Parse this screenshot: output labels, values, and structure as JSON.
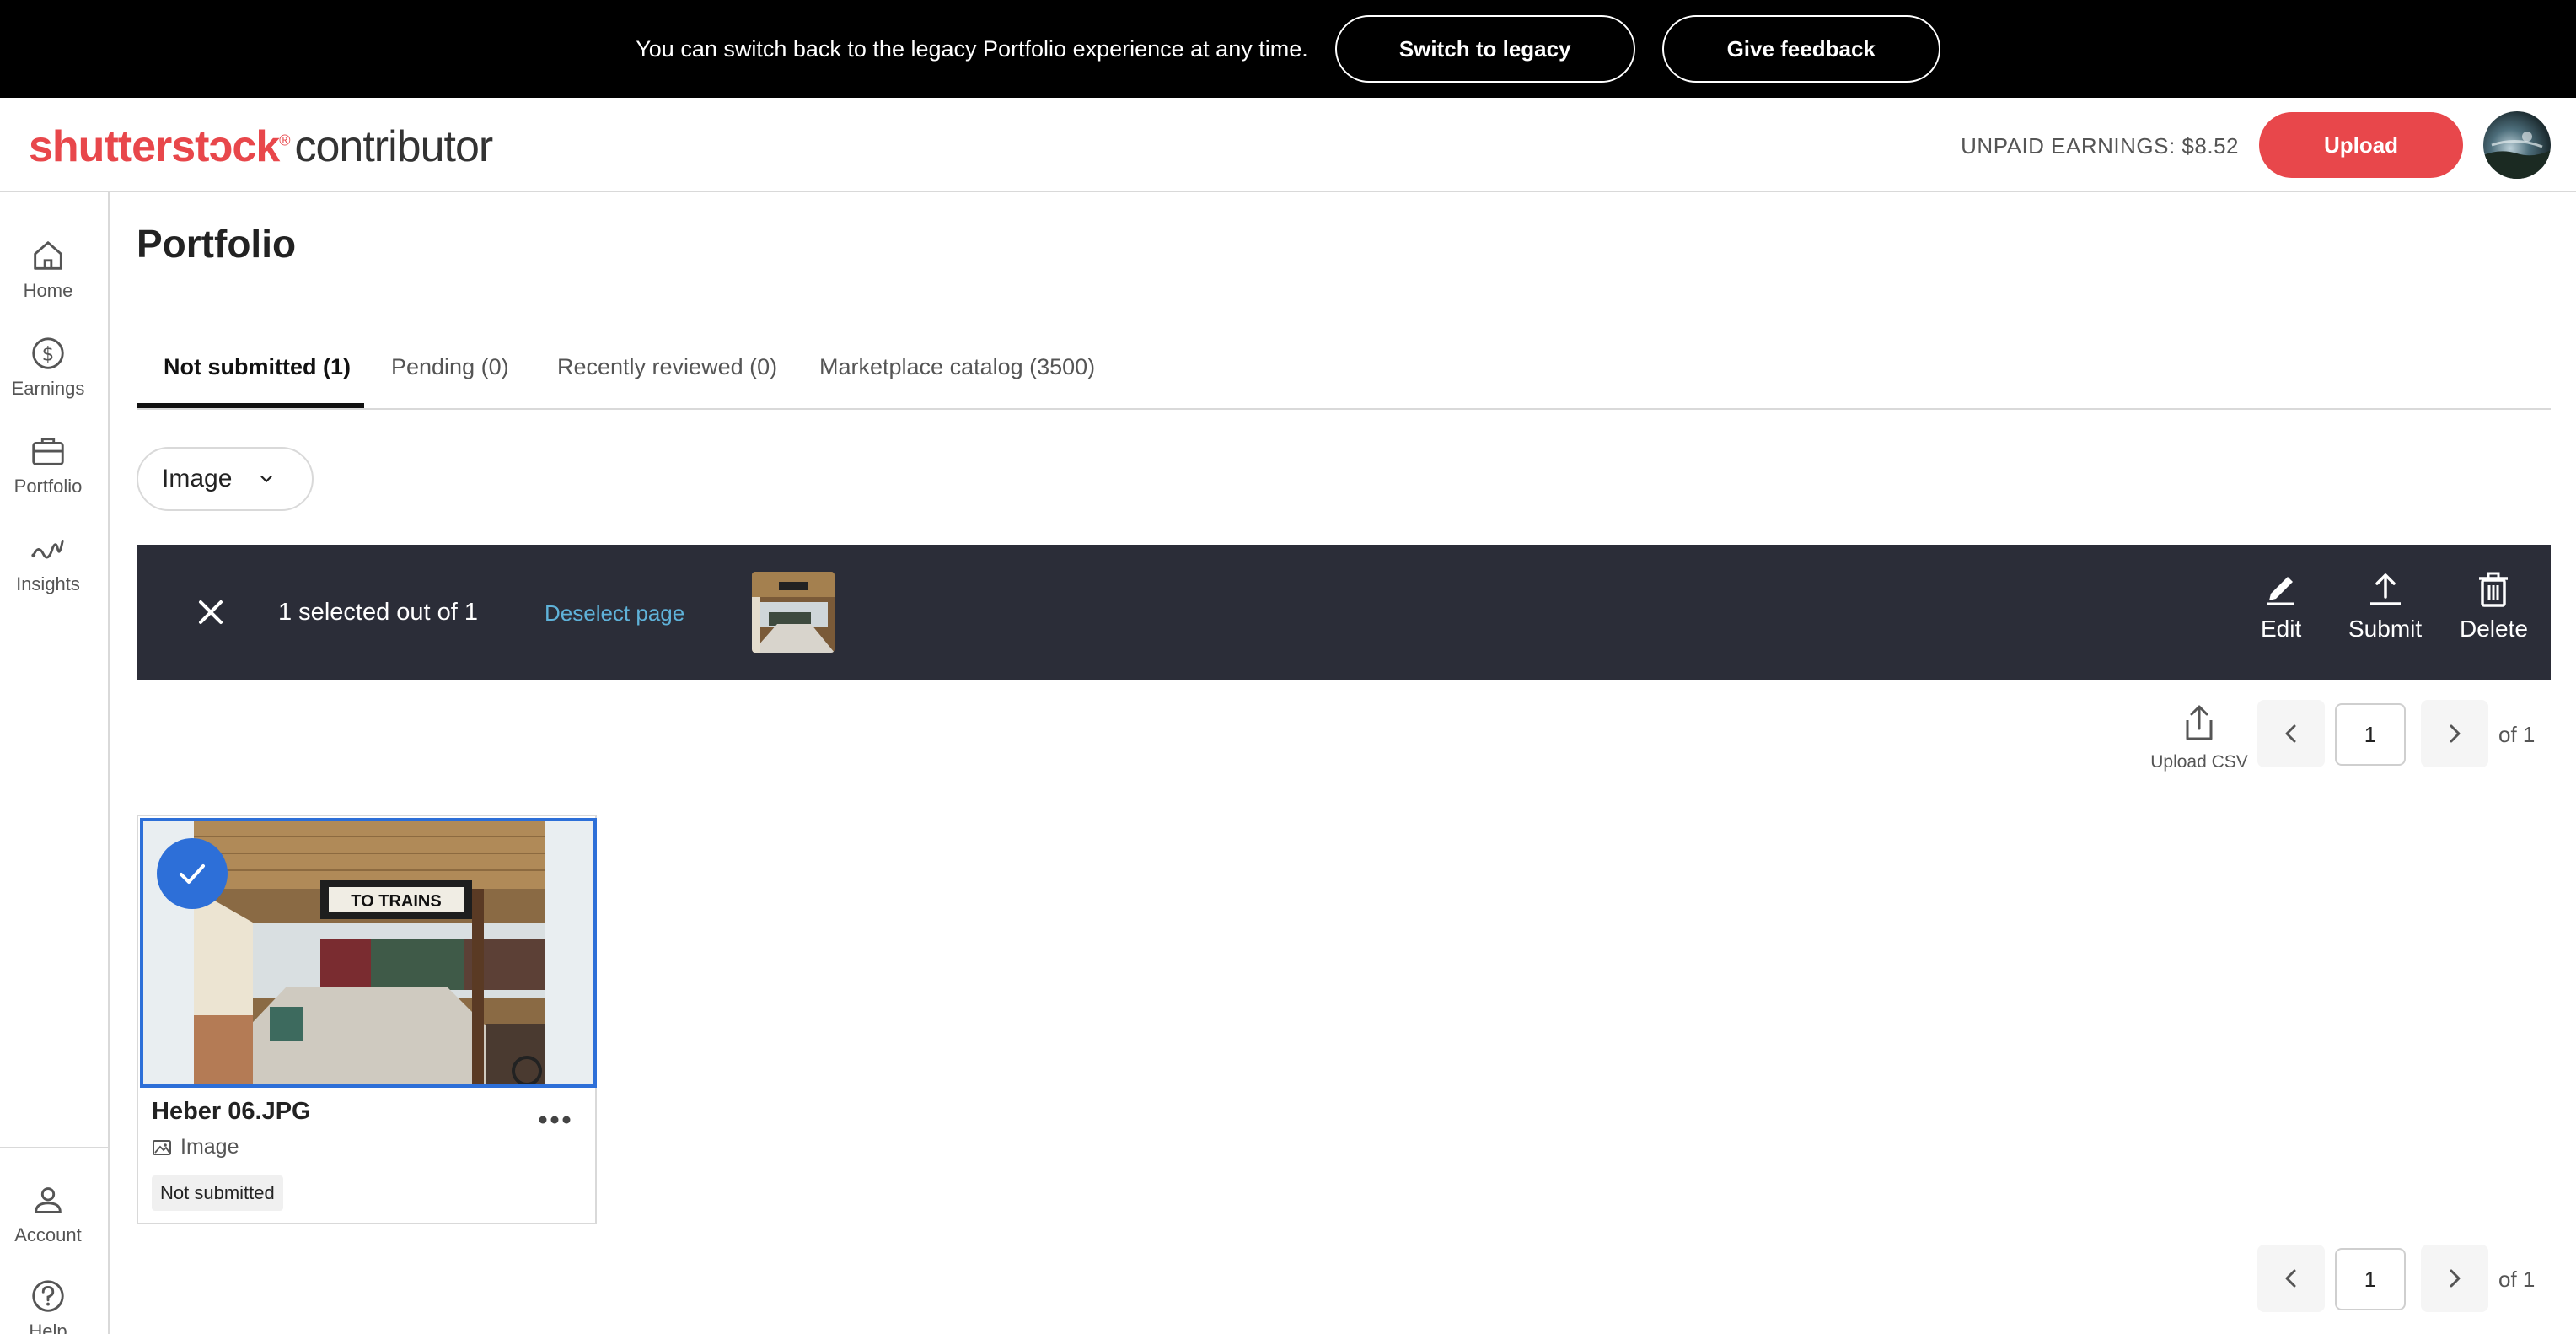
{
  "banner": {
    "message": "You can switch back to the legacy Portfolio experience at any time.",
    "switch_label": "Switch to legacy",
    "feedback_label": "Give feedback"
  },
  "header": {
    "brand": "shutterstɔck",
    "brand_suffix": "contributor",
    "earnings": "UNPAID EARNINGS: $8.52",
    "upload_label": "Upload"
  },
  "sidebar": {
    "items": [
      {
        "label": "Home",
        "icon": "home-icon"
      },
      {
        "label": "Earnings",
        "icon": "dollar-icon"
      },
      {
        "label": "Portfolio",
        "icon": "briefcase-icon"
      },
      {
        "label": "Insights",
        "icon": "insights-icon"
      }
    ],
    "bottom": [
      {
        "label": "Account",
        "icon": "person-icon"
      },
      {
        "label": "Help",
        "icon": "help-icon"
      }
    ]
  },
  "page": {
    "title": "Portfolio",
    "tabs": [
      {
        "label": "Not submitted (1)",
        "active": true
      },
      {
        "label": "Pending (0)",
        "active": false
      },
      {
        "label": "Recently reviewed (0)",
        "active": false
      },
      {
        "label": "Marketplace catalog (3500)",
        "active": false
      }
    ],
    "filter_value": "Image"
  },
  "selection": {
    "count_text": "1 selected out of 1",
    "deselect_label": "Deselect page",
    "actions": {
      "edit": "Edit",
      "submit": "Submit",
      "delete": "Delete"
    }
  },
  "pagination": {
    "upload_csv_label": "Upload CSV",
    "current_page": "1",
    "total_text": "of 1"
  },
  "assets": [
    {
      "title": "Heber 06.JPG",
      "type": "Image",
      "status": "Not submitted",
      "selected": true,
      "sign_text": "TO TRAINS"
    }
  ],
  "colors": {
    "brand_red": "#e8474b",
    "selection_bar": "#2b2d38",
    "selected_blue": "#2d6fd8",
    "link_blue": "#5fb2d9"
  }
}
